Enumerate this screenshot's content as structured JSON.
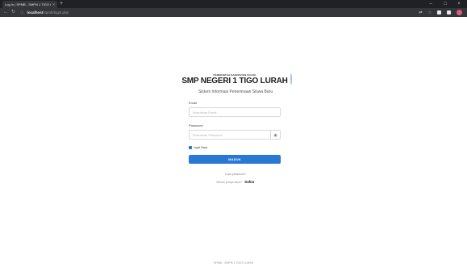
{
  "browser": {
    "tab_title": "Log In | SPMB - SMPN 1 TIGO LU…",
    "close_glyph": "×",
    "new_tab_glyph": "+",
    "url_host": "localhost",
    "url_path": "/spmb/login.php",
    "window_controls": [
      "–",
      "□",
      "×"
    ]
  },
  "brand": {
    "crest_icon": "regency-crest-icon",
    "subtitle_small": "PEMERINTAH KABUPATEN SOLOK",
    "school_name": "SMP NEGERI 1 TIGO LURAH",
    "tutwuri_icon": "tut-wuri-handayani-logo"
  },
  "login": {
    "system_title": "Sistem Informasi Penerimaan Siswa Baru",
    "email_label": "Email",
    "email_placeholder": "Masukkan Email",
    "password_label": "Password",
    "password_placeholder": "Masukkan Password",
    "remember_label": "Ingat Saya",
    "submit_label": "MASUK",
    "forgot_label": "Lupa password?",
    "register_prompt": "Belum punya akun?",
    "register_link": "Daftar"
  },
  "footer": {
    "text": "SPMB - SMPN 1 TIGO LURAH"
  },
  "colors": {
    "primary": "#2a78d6",
    "chrome_dark": "#202124",
    "chrome_toolbar": "#35363a"
  }
}
